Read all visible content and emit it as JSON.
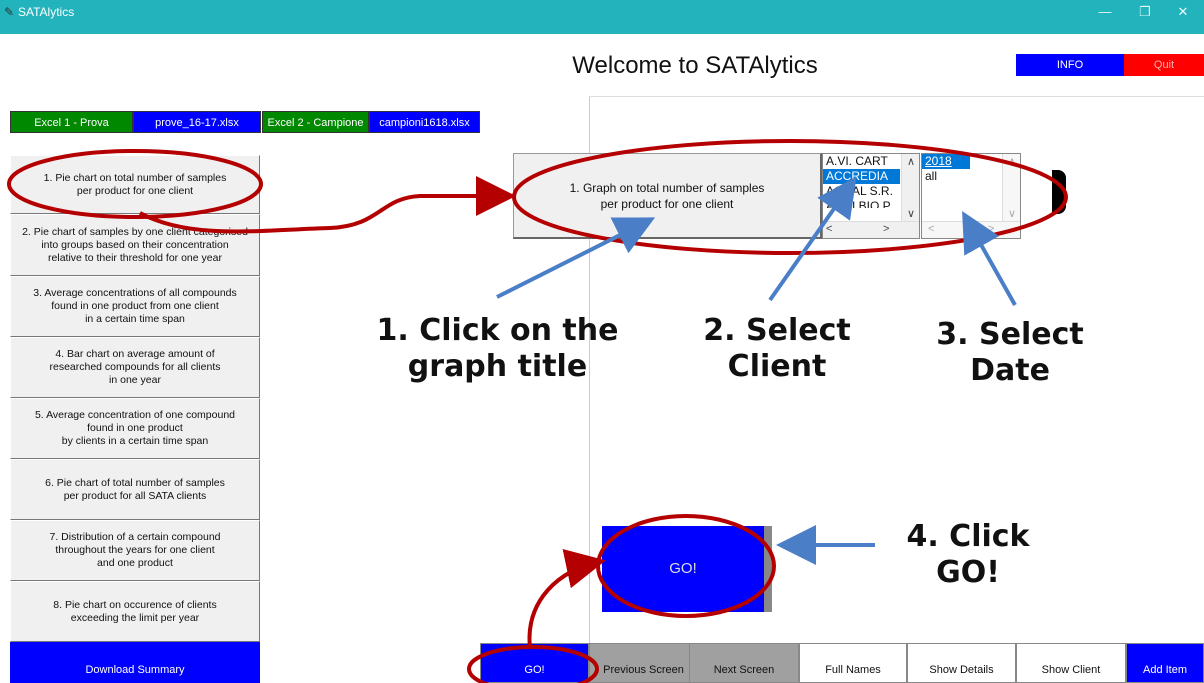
{
  "window": {
    "title": "SATAlytics",
    "app_icon": "feather-icon",
    "minimize": "—",
    "maximize": "❐",
    "close": "✕"
  },
  "header": {
    "title": "Welcome to SATAlytics",
    "info_label": "INFO",
    "quit_label": "Quit"
  },
  "excel": {
    "excel1_label": "Excel 1 - Prova",
    "excel1_file": "prove_16-17.xlsx",
    "excel2_label": "Excel 2 - Campione",
    "excel2_file": "campioni1618.xlsx"
  },
  "menu": {
    "items": [
      {
        "label": "1. Pie chart on total number of samples\nper product for one client"
      },
      {
        "label": "2. Pie chart of samples by one client categorised\ninto groups based on their concentration\nrelative to their threshold for one year"
      },
      {
        "label": "3. Average concentrations of all compounds\nfound in one product from one client\nin a certain time span"
      },
      {
        "label": "4. Bar chart on average amount of\nresearched compounds for all clients\nin one year"
      },
      {
        "label": "5. Average concentration of one compound\nfound in one product\nby clients in a certain time span"
      },
      {
        "label": "6. Pie chart of total number of samples\nper product for all SATA clients"
      },
      {
        "label": "7. Distribution of a certain compound\nthroughout the years for one client\nand one product"
      },
      {
        "label": "8. Pie chart on occurence of clients\nexceeding the limit per year"
      }
    ],
    "download_label": "Download Summary"
  },
  "selection": {
    "graph_title": "1. Graph on total number of samples\nper product for one client",
    "clients": [
      "A.VI. CART",
      "ACCREDIA",
      "AGRAL S.R.",
      "AGRI BIO P"
    ],
    "selected_client": "ACCREDIA",
    "dates": [
      "2018",
      "all"
    ],
    "selected_date": "2018"
  },
  "go_label": "GO!",
  "bottom_bar": {
    "go": "GO!",
    "previous": "Previous Screen",
    "next": "Next Screen",
    "full_names": "Full Names",
    "show_details": "Show Details",
    "show_client": "Show Client",
    "add_item": "Add Item"
  },
  "callouts": {
    "step1": "1. Click on the\ngraph title",
    "step2": "2. Select\nClient",
    "step3": "3. Select\nDate",
    "step4": "4. Click\nGO!"
  },
  "colors": {
    "titlebar": "#22b3bd",
    "button_blue": "#0000ff",
    "quit_red": "#ff0000",
    "excel_green": "#008800",
    "annotation_red": "#b40000",
    "arrow_blue": "#4a7fc8"
  }
}
